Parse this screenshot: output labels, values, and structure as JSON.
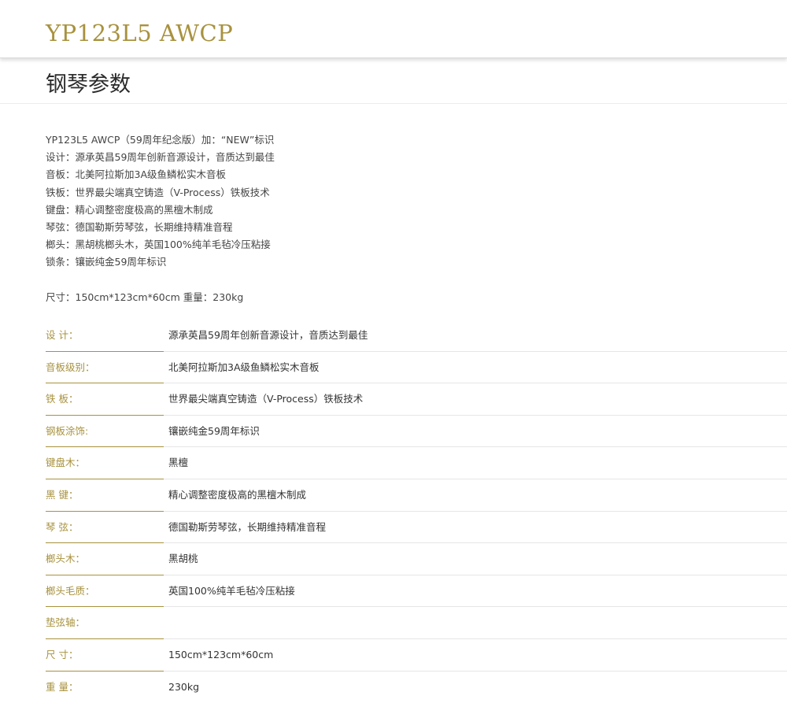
{
  "header": {
    "model": "YP123L5 AWCP"
  },
  "section": {
    "title": "钢琴参数"
  },
  "intro_lines": [
    "YP123L5 AWCP（59周年纪念版）加：“NEW”标识",
    "设计：源承英昌59周年创新音源设计，音质达到最佳",
    "音板：北美阿拉斯加3A级鱼鳞松实木音板",
    "铁板：世界最尖端真空铸造（V-Process）铁板技术",
    "键盘：精心调整密度极高的黑檀木制成",
    "琴弦：德国勒斯劳琴弦，长期维持精准音程",
    "榔头：黑胡桃榔头木，英国100%纯羊毛毡冷压粘接",
    "锁条：镶嵌纯金59周年标识"
  ],
  "dimensions_line": "尺寸：150cm*123cm*60cm  重量：230kg",
  "specs": [
    {
      "label": "设 计：",
      "value": "源承英昌59周年创新音源设计，音质达到最佳"
    },
    {
      "label": "音板级别：",
      "value": "北美阿拉斯加3A级鱼鳞松实木音板"
    },
    {
      "label": "铁 板：",
      "value": "世界最尖端真空铸造（V-Process）铁板技术"
    },
    {
      "label": "钢板涂饰:",
      "value": "镶嵌纯金59周年标识"
    },
    {
      "label": "键盘木：",
      "value": "黑檀"
    },
    {
      "label": "黑 键：",
      "value": "精心调整密度极高的黑檀木制成"
    },
    {
      "label": "琴 弦：",
      "value": "德国勒斯劳琴弦，长期维持精准音程"
    },
    {
      "label": "榔头木：",
      "value": "黑胡桃"
    },
    {
      "label": "榔头毛质：",
      "value": "英国100%纯羊毛毡冷压粘接"
    },
    {
      "label": "垫弦轴：",
      "value": ""
    },
    {
      "label": "尺 寸：",
      "value": "150cm*123cm*60cm"
    },
    {
      "label": "重 量：",
      "value": "230kg"
    }
  ],
  "colors": {
    "accent_gold": "#a8923e",
    "text": "#333333",
    "divider": "#e6e6e6"
  }
}
